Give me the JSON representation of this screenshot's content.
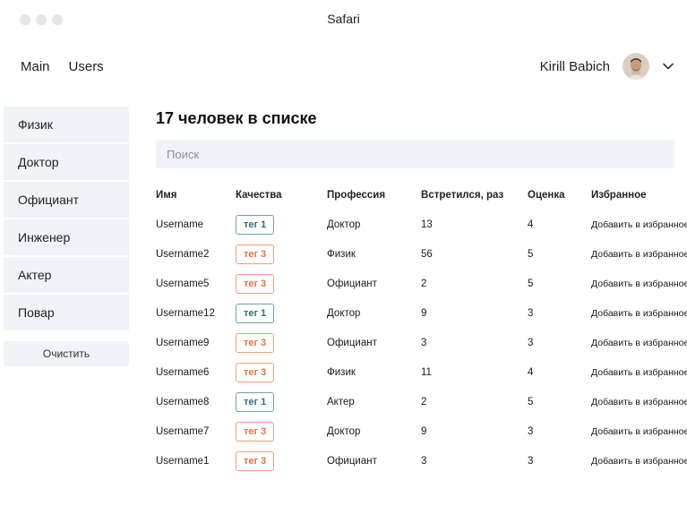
{
  "window": {
    "title": "Safari"
  },
  "nav": {
    "links": [
      "Main",
      "Users"
    ]
  },
  "user": {
    "name": "Kirill Babich"
  },
  "sidebar": {
    "items": [
      "Физик",
      "Доктор",
      "Официант",
      "Инженер",
      "Актер",
      "Повар"
    ],
    "clear_label": "Очистить"
  },
  "main": {
    "title": "17 человек в списке",
    "search_placeholder": "Поиск"
  },
  "table": {
    "headers": {
      "name": "Имя",
      "qualities": "Качества",
      "profession": "Профессия",
      "met": "Встретился, раз",
      "score": "Оценка",
      "favorite": "Избранное"
    },
    "rows": [
      {
        "name": "Username",
        "tag": "тег 1",
        "tag_type": "t1",
        "profession": "Доктор",
        "met": "13",
        "score": "4",
        "favorite": "Добавить в избранное"
      },
      {
        "name": "Username2",
        "tag": "тег 3",
        "tag_type": "t3",
        "profession": "Физик",
        "met": "56",
        "score": "5",
        "favorite": "Добавить в избранное"
      },
      {
        "name": "Username5",
        "tag": "тег 3",
        "tag_type": "t3",
        "profession": "Официант",
        "met": "2",
        "score": "5",
        "favorite": "Добавить в избранное"
      },
      {
        "name": "Username12",
        "tag": "тег 1",
        "tag_type": "t1",
        "profession": "Доктор",
        "met": "9",
        "score": "3",
        "favorite": "Добавить в избранное"
      },
      {
        "name": "Username9",
        "tag": "тег 3",
        "tag_type": "t3",
        "profession": "Официант",
        "met": "3",
        "score": "3",
        "favorite": "Добавить в избранное"
      },
      {
        "name": "Username6",
        "tag": "тег 3",
        "tag_type": "t3",
        "profession": "Физик",
        "met": "11",
        "score": "4",
        "favorite": "Добавить в избранное"
      },
      {
        "name": "Username8",
        "tag": "тег 1",
        "tag_type": "t1",
        "profession": "Актер",
        "met": "2",
        "score": "5",
        "favorite": "Добавить в избранное"
      },
      {
        "name": "Username7",
        "tag": "тег 3",
        "tag_type": "t3",
        "profession": "Доктор",
        "met": "9",
        "score": "3",
        "favorite": "Добавить в избранное"
      },
      {
        "name": "Username1",
        "tag": "тег 3",
        "tag_type": "t3",
        "profession": "Официант",
        "met": "3",
        "score": "3",
        "favorite": "Добавить в избранное"
      }
    ]
  },
  "colors": {
    "sidebar_bg": "#f0f3f8",
    "tag1": "#2f6f74",
    "tag3": "#e5733f"
  }
}
